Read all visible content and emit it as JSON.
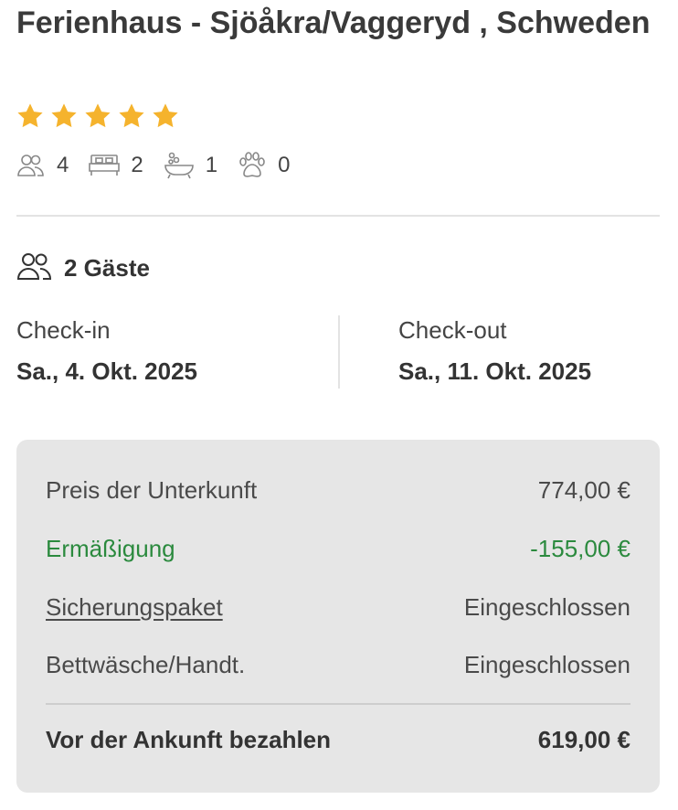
{
  "listing": {
    "title": "Ferienhaus - Sjöåkra/Vaggeryd , Schweden",
    "rating_stars": 5,
    "star_color": "#f5b32d",
    "features": [
      {
        "icon": "people-icon",
        "count": "4"
      },
      {
        "icon": "bed-icon",
        "count": "2"
      },
      {
        "icon": "bathtub-icon",
        "count": "1"
      },
      {
        "icon": "paw-icon",
        "count": "0"
      }
    ]
  },
  "booking": {
    "guests_label": "2 Gäste",
    "checkin_label": "Check-in",
    "checkin_value": "Sa., 4. Okt. 2025",
    "checkout_label": "Check-out",
    "checkout_value": "Sa., 11. Okt. 2025"
  },
  "price": {
    "rows": [
      {
        "label": "Preis der Unterkunft",
        "value": "774,00 €"
      },
      {
        "label": "Ermäßigung",
        "value": "-155,00 €"
      },
      {
        "label": "Sicherungspaket",
        "value": "Eingeschlossen"
      },
      {
        "label": "Bettwäsche/Handt.",
        "value": "Eingeschlossen"
      }
    ],
    "total_label": "Vor der Ankunft bezahlen",
    "total_value": "619,00 €",
    "discount_color": "#2b8a3e"
  }
}
